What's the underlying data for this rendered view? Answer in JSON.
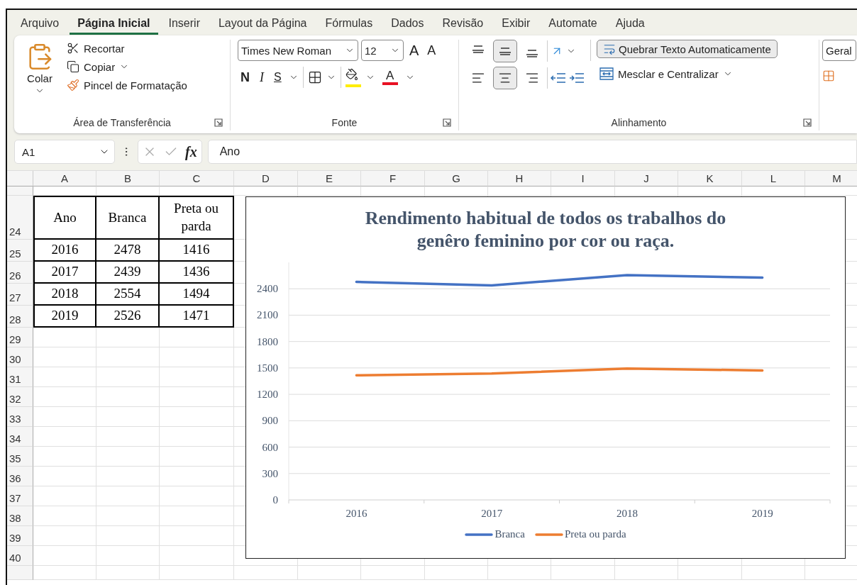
{
  "menu_tabs": [
    {
      "label": "Arquivo",
      "selected": false
    },
    {
      "label": "Página Inicial",
      "selected": true
    },
    {
      "label": "Inserir",
      "selected": false
    },
    {
      "label": "Layout da Página",
      "selected": false
    },
    {
      "label": "Fórmulas",
      "selected": false
    },
    {
      "label": "Dados",
      "selected": false
    },
    {
      "label": "Revisão",
      "selected": false
    },
    {
      "label": "Exibir",
      "selected": false
    },
    {
      "label": "Automate",
      "selected": false
    },
    {
      "label": "Ajuda",
      "selected": false
    }
  ],
  "ribbon": {
    "clipboard": {
      "paste": "Colar",
      "cut": "Recortar",
      "copy": "Copiar",
      "format_painter": "Pincel de Formatação",
      "label": "Área de Transferência"
    },
    "font": {
      "name": "Times New Roman",
      "size": "12",
      "grow": "A",
      "shrink": "A",
      "bold": "N",
      "italic": "I",
      "underline": "S",
      "font_color": "A",
      "label": "Fonte"
    },
    "alignment": {
      "vertical": [
        {
          "selected": false
        },
        {
          "selected": true
        },
        {
          "selected": false
        }
      ],
      "horizontal": [
        {
          "selected": false
        },
        {
          "selected": true
        },
        {
          "selected": false
        }
      ],
      "wrap_text": {
        "label": "Quebrar Texto Automaticamente",
        "on": true
      },
      "merge": "Mesclar e Centralizar",
      "label": "Alinhamento"
    },
    "number": {
      "format": "Geral"
    }
  },
  "formula_bar": {
    "name_box": "A1",
    "fx": "fx",
    "formula": "Ano"
  },
  "sheet": {
    "columns": [
      "A",
      "B",
      "C",
      "D",
      "E",
      "F",
      "G",
      "H",
      "I",
      "J",
      "K",
      "L",
      "M"
    ],
    "rows": [
      {
        "number": "24",
        "cells": [
          "Ano",
          "Branca",
          "Preta ou parda"
        ]
      },
      {
        "number": "25",
        "cells": [
          "2016",
          "2478",
          "1416"
        ]
      },
      {
        "number": "26",
        "cells": [
          "2017",
          "2439",
          "1436"
        ]
      },
      {
        "number": "27",
        "cells": [
          "2018",
          "2554",
          "1494"
        ]
      },
      {
        "number": "28",
        "cells": [
          "2019",
          "2526",
          "1471"
        ]
      },
      {
        "number": "29"
      },
      {
        "number": "30"
      },
      {
        "number": "31"
      },
      {
        "number": "32"
      },
      {
        "number": "33"
      },
      {
        "number": "34"
      },
      {
        "number": "35"
      },
      {
        "number": "36"
      },
      {
        "number": "37"
      },
      {
        "number": "38"
      },
      {
        "number": "39"
      },
      {
        "number": "40"
      }
    ]
  },
  "chart": {
    "chart_data": {
      "type": "line",
      "title": "Rendimento habitual de todos os trabalhos do genêro feminino por cor ou raça.",
      "categories": [
        "2016",
        "2017",
        "2018",
        "2019"
      ],
      "series": [
        {
          "name": "Branca",
          "color": "#4472c4",
          "values": [
            2478,
            2439,
            2554,
            2526
          ]
        },
        {
          "name": "Preta ou parda",
          "color": "#ed7d31",
          "values": [
            1416,
            1436,
            1494,
            1471
          ]
        }
      ],
      "ylim": [
        0,
        2700
      ],
      "grid": true,
      "yticks": [
        0,
        300,
        600,
        900,
        1200,
        1500,
        1800,
        2100,
        2400
      ]
    }
  }
}
